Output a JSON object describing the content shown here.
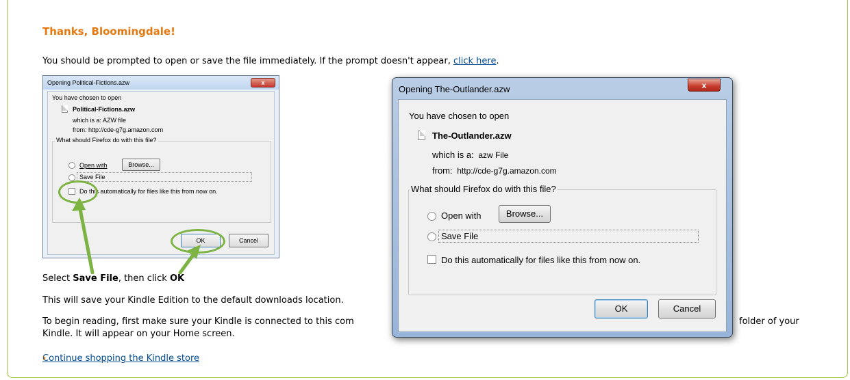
{
  "heading": "Thanks, Bloomingdale!",
  "intro": {
    "text": "You should be prompted to open or save the file immediately. If the prompt doesn't appear, ",
    "link": "click here",
    "after": "."
  },
  "small_dialog": {
    "title": "Opening Political-Fictions.azw",
    "chosen": "You have chosen to open",
    "filename": "Political-Fictions.azw",
    "which_is": "which is a:  AZW file",
    "from": "from:  http://cde-g7g.amazon.com",
    "question": "What should Firefox do with this file?",
    "open_with": "Open with",
    "browse": "Browse...",
    "save_file": "Save File",
    "auto": "Do this automatically for files like this from now on.",
    "ok": "OK",
    "cancel": "Cancel",
    "close": "x"
  },
  "instruction": {
    "pre": "Select ",
    "bold1": "Save File",
    "mid": ", then click ",
    "bold2": "OK"
  },
  "save_note": "This will save your Kindle Edition to the default downloads location.",
  "begin_reading": {
    "part1": "To begin reading, first make sure your Kindle is connected to this com",
    "part2": "folder of your",
    "line2": "Kindle. It will appear on your Home screen."
  },
  "continue_link": "Continue shopping the Kindle store",
  "continue_arrow": "›",
  "large_dialog": {
    "title": "Opening The-Outlander.azw",
    "chosen": "You have chosen to open",
    "filename": "The-Outlander.azw",
    "which_label": "which is a:",
    "which_value": "azw File",
    "from_label": "from:",
    "from_value": "http://cde-g7g.amazon.com",
    "question": "What should Firefox do with this file?",
    "open_with": "Open with",
    "browse": "Browse...",
    "save_file": "Save File",
    "auto": "Do this automatically for files like this from now on.",
    "ok": "OK",
    "cancel": "Cancel",
    "close": "x"
  },
  "colors": {
    "heading": "#e47911",
    "link": "#004b91",
    "border": "#9ccb3b",
    "highlight": "#7cb342"
  }
}
